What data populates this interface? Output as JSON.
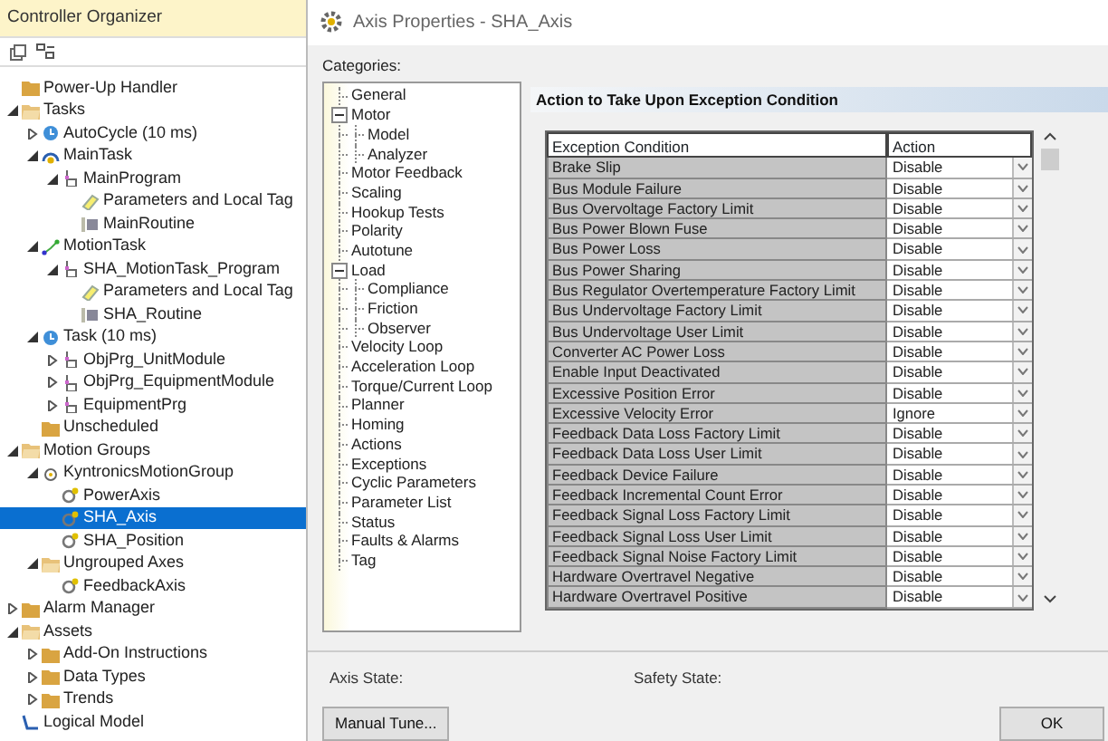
{
  "organizer": {
    "title": "Controller Organizer",
    "tree": [
      {
        "label": "Power-Up Handler",
        "kind": "folder"
      },
      {
        "label": "Tasks",
        "kind": "openfolder",
        "expanded": true,
        "children": [
          {
            "label": "AutoCycle (10 ms)",
            "kind": "clock",
            "expanded": false
          },
          {
            "label": "MainTask",
            "kind": "task",
            "expanded": true,
            "children": [
              {
                "label": "MainProgram",
                "kind": "program",
                "expanded": true,
                "children": [
                  {
                    "label": "Parameters and Local Tag",
                    "kind": "tags"
                  },
                  {
                    "label": "MainRoutine",
                    "kind": "routine"
                  }
                ]
              }
            ]
          },
          {
            "label": "MotionTask",
            "kind": "motion",
            "expanded": true,
            "children": [
              {
                "label": "SHA_MotionTask_Program",
                "kind": "program",
                "expanded": true,
                "children": [
                  {
                    "label": "Parameters and Local Tag",
                    "kind": "tags"
                  },
                  {
                    "label": "SHA_Routine",
                    "kind": "routine"
                  }
                ]
              }
            ]
          },
          {
            "label": "Task (10 ms)",
            "kind": "clock",
            "expanded": true,
            "children": [
              {
                "label": "ObjPrg_UnitModule",
                "kind": "program",
                "expanded": false
              },
              {
                "label": "ObjPrg_EquipmentModule",
                "kind": "program",
                "expanded": false
              },
              {
                "label": "EquipmentPrg",
                "kind": "program",
                "expanded": false
              }
            ]
          },
          {
            "label": "Unscheduled",
            "kind": "folder"
          }
        ]
      },
      {
        "label": "Motion Groups",
        "kind": "openfolder",
        "expanded": true,
        "children": [
          {
            "label": "KyntronicsMotionGroup",
            "kind": "group",
            "expanded": true,
            "children": [
              {
                "label": "PowerAxis",
                "kind": "axis",
                "selected": false
              },
              {
                "label": "SHA_Axis",
                "kind": "axis",
                "selected": true
              },
              {
                "label": "SHA_Position",
                "kind": "axis",
                "selected": false
              }
            ]
          },
          {
            "label": "Ungrouped Axes",
            "kind": "openfolder",
            "expanded": true,
            "children": [
              {
                "label": "FeedbackAxis",
                "kind": "axis",
                "selected": false
              }
            ]
          }
        ]
      },
      {
        "label": "Alarm Manager",
        "kind": "folder",
        "expanded": false
      },
      {
        "label": "Assets",
        "kind": "openfolder",
        "expanded": true,
        "children": [
          {
            "label": "Add-On Instructions",
            "kind": "folder",
            "expanded": false
          },
          {
            "label": "Data Types",
            "kind": "folder",
            "expanded": false
          },
          {
            "label": "Trends",
            "kind": "folder",
            "expanded": false
          }
        ]
      },
      {
        "label": "Logical Model",
        "kind": "model"
      }
    ]
  },
  "dialog": {
    "title": "Axis Properties - SHA_Axis",
    "categories_label": "Categories:",
    "categories": [
      {
        "label": "General"
      },
      {
        "label": "Motor",
        "expanded": true,
        "children": [
          {
            "label": "Model"
          },
          {
            "label": "Analyzer"
          }
        ]
      },
      {
        "label": "Motor Feedback"
      },
      {
        "label": "Scaling"
      },
      {
        "label": "Hookup Tests"
      },
      {
        "label": "Polarity"
      },
      {
        "label": "Autotune"
      },
      {
        "label": "Load",
        "expanded": true,
        "children": [
          {
            "label": "Compliance"
          },
          {
            "label": "Friction"
          },
          {
            "label": "Observer"
          }
        ]
      },
      {
        "label": "Velocity Loop"
      },
      {
        "label": "Acceleration Loop"
      },
      {
        "label": "Torque/Current Loop"
      },
      {
        "label": "Planner"
      },
      {
        "label": "Homing"
      },
      {
        "label": "Actions"
      },
      {
        "label": "Exceptions"
      },
      {
        "label": "Cyclic Parameters"
      },
      {
        "label": "Parameter List"
      },
      {
        "label": "Status"
      },
      {
        "label": "Faults & Alarms"
      },
      {
        "label": "Tag"
      }
    ],
    "section_title": "Action to Take Upon Exception Condition",
    "table": {
      "columns": [
        "Exception Condition",
        "Action"
      ],
      "rows": [
        [
          "Brake Slip",
          "Disable"
        ],
        [
          "Bus Module Failure",
          "Disable"
        ],
        [
          "Bus Overvoltage Factory Limit",
          "Disable"
        ],
        [
          "Bus Power Blown Fuse",
          "Disable"
        ],
        [
          "Bus Power Loss",
          "Disable"
        ],
        [
          "Bus Power Sharing",
          "Disable"
        ],
        [
          "Bus Regulator Overtemperature Factory Limit",
          "Disable"
        ],
        [
          "Bus Undervoltage Factory Limit",
          "Disable"
        ],
        [
          "Bus Undervoltage User Limit",
          "Disable"
        ],
        [
          "Converter AC Power Loss",
          "Disable"
        ],
        [
          "Enable Input Deactivated",
          "Disable"
        ],
        [
          "Excessive Position Error",
          "Disable"
        ],
        [
          "Excessive Velocity Error",
          "Ignore"
        ],
        [
          "Feedback Data Loss Factory Limit",
          "Disable"
        ],
        [
          "Feedback Data Loss User Limit",
          "Disable"
        ],
        [
          "Feedback Device Failure",
          "Disable"
        ],
        [
          "Feedback Incremental Count Error",
          "Disable"
        ],
        [
          "Feedback Signal Loss Factory Limit",
          "Disable"
        ],
        [
          "Feedback Signal Loss User Limit",
          "Disable"
        ],
        [
          "Feedback Signal Noise Factory Limit",
          "Disable"
        ],
        [
          "Hardware Overtravel Negative",
          "Disable"
        ],
        [
          "Hardware Overtravel Positive",
          "Disable"
        ]
      ]
    },
    "axis_state_label": "Axis State:",
    "safety_state_label": "Safety State:",
    "buttons": [
      "Manual Tune...",
      "OK"
    ]
  }
}
